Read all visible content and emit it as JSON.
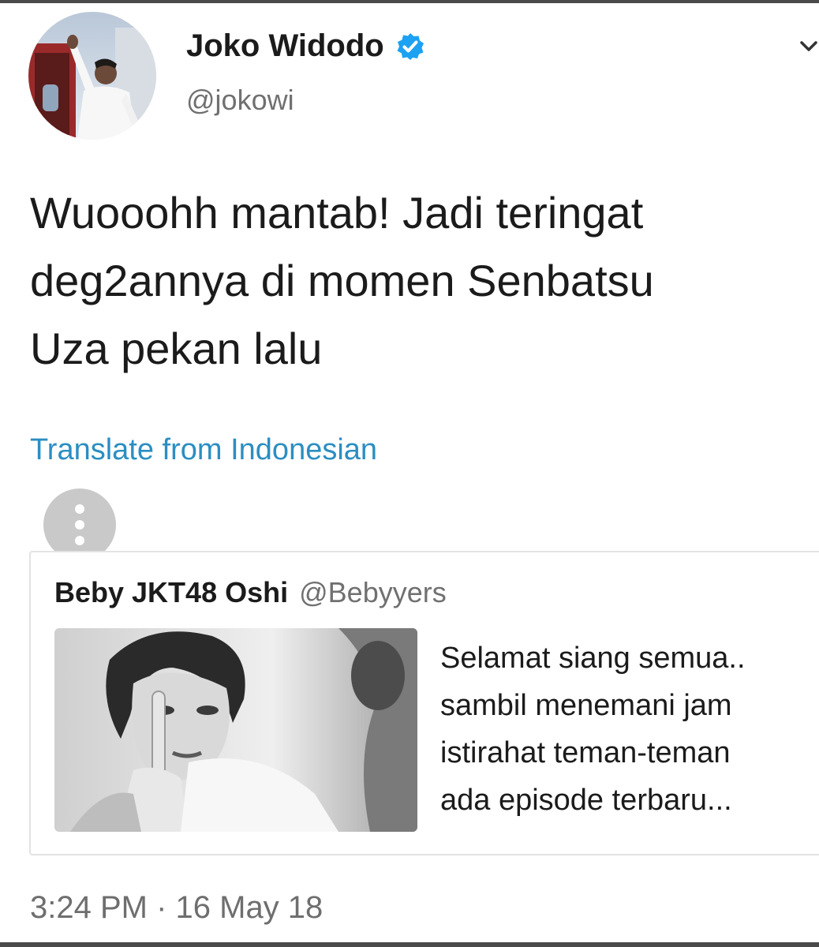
{
  "tweet": {
    "author": {
      "display_name": "Joko Widodo",
      "handle": "@jokowi",
      "verified": true,
      "avatar_icon": "profile-photo"
    },
    "text_lines": [
      "Wuooohh mantab! Jadi teringat",
      "deg2annya di momen Senbatsu",
      "Uza pekan lalu"
    ],
    "translate_link": "Translate from Indonesian",
    "timestamp": "3:24 PM · 16 May 18",
    "menu_icon": "chevron-down-icon",
    "more_icon": "vertical-ellipsis-icon"
  },
  "quoted_tweet": {
    "display_name": "Beby JKT48 Oshi",
    "handle": "@Bebyyers",
    "media_icon": "grayscale-photo",
    "text_lines": [
      "Selamat siang semua..",
      "sambil menemani jam",
      "istirahat teman-teman",
      "ada episode terbaru..."
    ]
  },
  "colors": {
    "link": "#2b8ec2",
    "verified_badge": "#1da1f2",
    "secondary_text": "#707070",
    "more_button_bg": "#c9c9c9",
    "frame": "#4a4a4a"
  }
}
